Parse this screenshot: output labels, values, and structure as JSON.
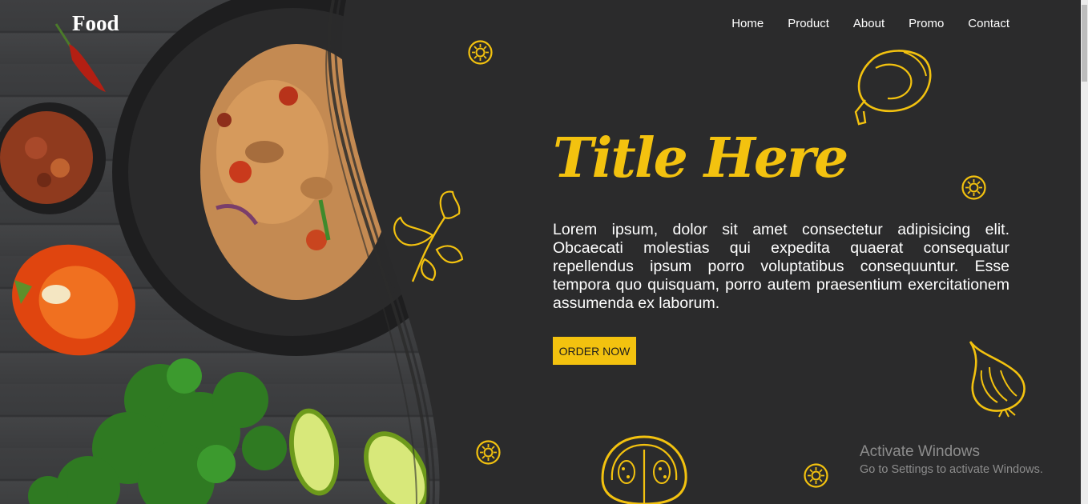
{
  "brand": {
    "logo": "Food"
  },
  "nav": {
    "items": [
      {
        "label": "Home"
      },
      {
        "label": "Product"
      },
      {
        "label": "About"
      },
      {
        "label": "Promo"
      },
      {
        "label": "Contact"
      }
    ]
  },
  "hero": {
    "title": "Title Here",
    "description": "Lorem ipsum, dolor sit amet consectetur adipisicing elit. Obcaecati molestias qui expedita quaerat consequatur repellendus ipsum porro voluptatibus consequuntur. Esse tempora quo quisquam, porro autem praesentium exercitationem assumenda ex laborum.",
    "cta_label": "ORDER NOW"
  },
  "watermark": {
    "line1": "Activate Windows",
    "line2": "Go to Settings to activate Windows."
  },
  "colors": {
    "accent": "#f3c20f",
    "background": "#2b2b2c",
    "text": "#ffffff"
  },
  "icons": [
    "kiwi-slice-icon",
    "bell-pepper-icon",
    "parsley-icon",
    "onion-icon",
    "tomato-half-icon"
  ]
}
